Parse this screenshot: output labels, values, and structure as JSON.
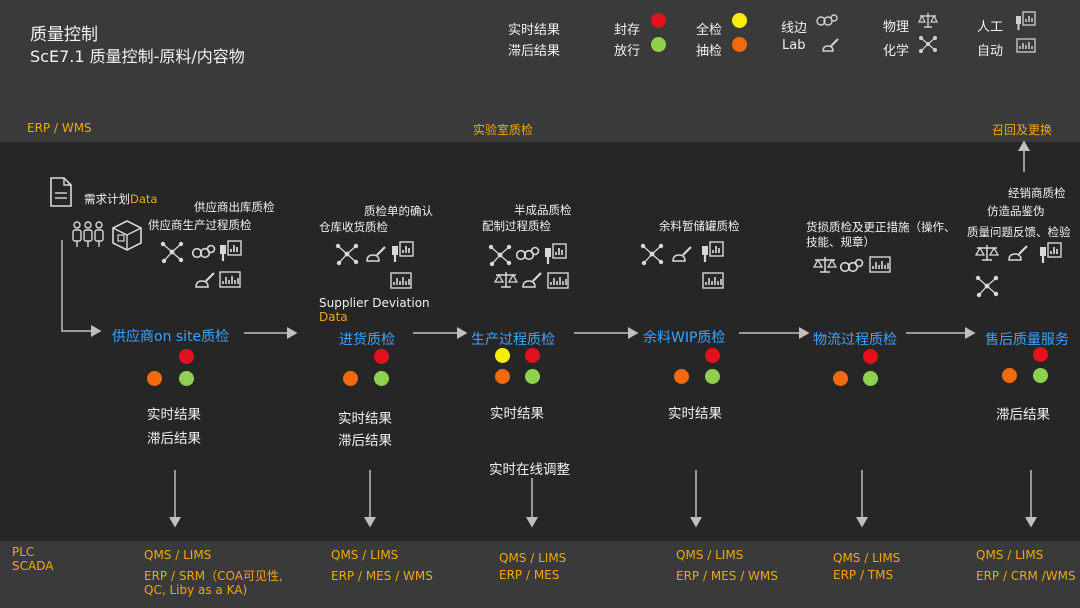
{
  "header": {
    "title": "质量控制",
    "subtitle": "ScE7.1 质量控制-原料/内容物"
  },
  "legend": {
    "realtime": "实时结果",
    "delayed": "滞后结果",
    "hold": "封存",
    "release": "放行",
    "full": "全检",
    "sampling": "抽检",
    "inline": "线边",
    "lab": "Lab",
    "physical": "物理",
    "chemical": "化学",
    "manual": "人工",
    "auto": "自动",
    "colors": {
      "hold": "#e3101e",
      "release": "#8fd14f",
      "full": "#f7ee0c",
      "sampling": "#f26a0c"
    }
  },
  "top_labels": {
    "erp_wms": "ERP  / WMS",
    "lab_qc": "实验室质检",
    "recall": "召回及更换"
  },
  "notes": {
    "demand": "需求计划",
    "demand_data": "Data",
    "supplier_out": "供应商出库质检",
    "supplier_proc": "供应商生产过程质检",
    "qc_confirm": "质检单的确认",
    "warehouse_recv": "仓库收货质检",
    "supplier_dev": "Supplier Deviation",
    "supplier_dev_data": "Data",
    "semi_finished": "半成品质检",
    "batching": "配制过程质检",
    "tank_storage": "余料暂储罐质检",
    "cargo_damage_1": "货损质检及更正措施（操作、",
    "cargo_damage_2": "技能、规章）",
    "dealer": "经销商质检",
    "counterfeit": "仿造品鉴伪",
    "feedback": "质量问题反馈、检验"
  },
  "stages": [
    {
      "name": "供应商on site质检",
      "result1": "实时结果",
      "result2": "滞后结果"
    },
    {
      "name": "进货质检",
      "result1": "实时结果",
      "result2": "滞后结果"
    },
    {
      "name": "生产过程质检",
      "result1": "实时结果",
      "result2": "实时在线调整"
    },
    {
      "name": "余料WIP质检",
      "result1": "实时结果",
      "result2": ""
    },
    {
      "name": "物流过程质检",
      "result1": "",
      "result2": ""
    },
    {
      "name": "售后质量服务",
      "result1": "滞后结果",
      "result2": ""
    }
  ],
  "bottom": {
    "plc": "PLC",
    "scada": "SCADA",
    "sys1_a": "QMS / LIMS",
    "sys1_b": "ERP / SRM（COA可见性,",
    "sys1_c": "QC, Liby as a KA)",
    "sys2_a": "QMS / LIMS",
    "sys2_b": "ERP / MES / WMS",
    "sys3_a": "QMS / LIMS",
    "sys3_b": "ERP /  MES",
    "sys4_a": "QMS / LIMS",
    "sys4_b": "ERP / MES / WMS",
    "sys5_a": "QMS / LIMS",
    "sys5_b": "ERP / TMS",
    "sys6_a": "QMS / LIMS",
    "sys6_b": "ERP / CRM /WMS"
  }
}
